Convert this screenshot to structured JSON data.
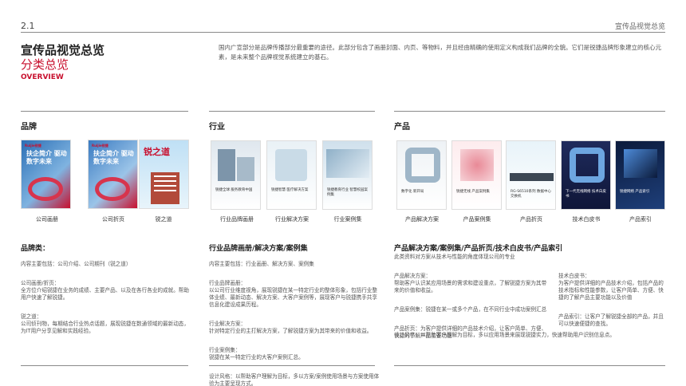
{
  "page_number": "2.1",
  "breadcrumb": "宣传品视觉总览",
  "title": "宣传品视觉总览",
  "subtitle": "分类总览",
  "subtitle_en": "OVERVIEW",
  "intro": "国内广宣部分是品牌传播部分最重要的途径。此部分包含了画册封面、内页、等物料，并且经由精确的使用定义构成我们品牌的全貌。它们是锐捷品牌形象建立的核心元素，是未来整个品牌视觉系统建立的基石。",
  "brand": {
    "heading": "品牌",
    "thumbs": [
      {
        "caption": "公司画册",
        "cover_text": "扶企简介 驱动数字未来",
        "logo": "Ruijie锐捷"
      },
      {
        "caption": "公司折页",
        "cover_text": "扶企简介 驱动数字未来",
        "logo": "Ruijie锐捷"
      },
      {
        "caption": "锐之道",
        "cover_text": "锐之道"
      }
    ],
    "desc_title": "品牌类：",
    "desc_lines": [
      "内容主要包括：公司介绍、公司期刊（锐之道）",
      "公司画册/折页：\n全方位介绍锐捷在业务的成绩、主要产品、以及在各行各业的成就。帮助用户快速了解锐捷。",
      "锐之道：\n公司侦刊物，每期结合行业热点话题，展现锐捷在数通领域的最新动态，为IT用户分享见解和实践经验。"
    ]
  },
  "industry": {
    "heading": "行业",
    "thumbs": [
      {
        "caption": "行业品牌画册",
        "cover_text": "锐捷全球 服务教育中国"
      },
      {
        "caption": "行业解决方案",
        "cover_text": "锐捷智慧 医疗解决方案"
      },
      {
        "caption": "行业案例集",
        "cover_text": "锐捷教育行业 智慧校园案例集"
      }
    ],
    "desc_title": "行业品牌画册/解决方案/案例集",
    "desc_lines": [
      "内容主要包括：行业画册、解决方案、案例集",
      "行业品牌画册：\n以公司行业维度视角，展现锐捷在某一特定行业的整体形象，包括行业整体业绩、最新动态、解决方案、大客户案例等，展现客户与锐捷携手共享信息化建设成果历程。",
      "行业解决方案：\n针对特定行业的主打解决方案，了解锐捷方案为其带来的价值和收益。",
      "行业案例集：\n锐捷在某一特定行业的大客户案例汇总。",
      "设计风格：以帮助客户理解为目标，多以方案/案例使用场景与方案使用体验为主要呈现方式。"
    ]
  },
  "product": {
    "heading": "产品",
    "thumbs": [
      {
        "caption": "产品解决方案",
        "cover_text": "数字化 新开局"
      },
      {
        "caption": "产品案例集",
        "cover_text": "锐捷无线 产品案例集"
      },
      {
        "caption": "产品折页",
        "cover_text": "RG-S6510系列 数据中心交换机"
      },
      {
        "caption": "技术白皮书",
        "cover_text": "下一代无线网络 技术白皮书"
      },
      {
        "caption": "产品索引",
        "cover_text": "锐捷网络 产品索引"
      }
    ],
    "desc_title": "产品解决方案/案例集/产品折页/技术白皮书/产品索引",
    "desc_intro": "此类资料对方案从技术与性能的角度体现公司的专业",
    "desc_left": [
      "产品解决方案：\n帮助客户认识某应用场景的需求和建设重点，了解锐捷方案为其带来的价值和收益。",
      "产品案例集：锐捷在某一或多个产品，在不同行业中成功案例汇总",
      "产品折页：为客户提供详细的产品技术介绍，让客户简单、方便、快捷的了解产品主要功能"
    ],
    "desc_right": [
      "技术白皮书：\n为客户提供详细的产品技术介绍，包括产品的技术指标和性能参数，让客户简单、方便、快捷的了解产品主要功能以及价值",
      "产品索引：让客户了解锐捷全部的产品，并且可以快速便捷的查找。"
    ],
    "desc_footer": "设计风格：以帮助客户理解为目标，多以应用场景来展现锐捷实力，快速帮助用户识别信息点。"
  },
  "colors": {
    "accent": "#c8102e",
    "rule": "#8a8a8a",
    "text": "#555555"
  }
}
